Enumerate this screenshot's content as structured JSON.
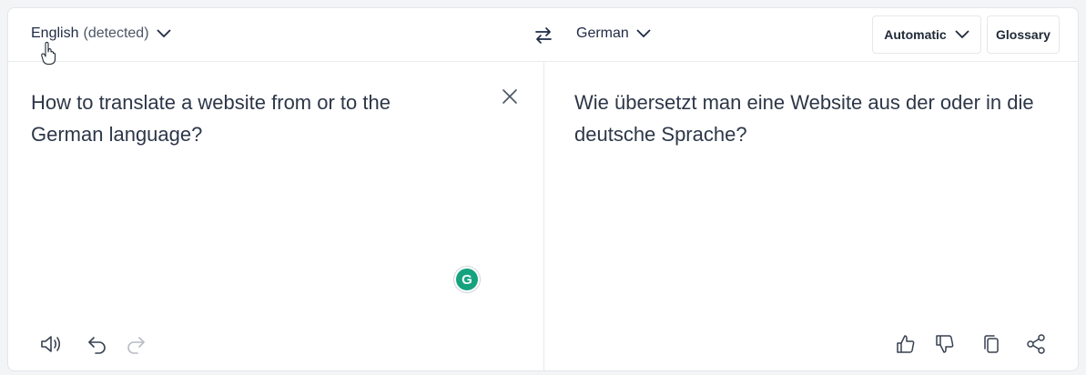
{
  "source": {
    "language": "English",
    "detected_label": "(detected)",
    "text": "How to translate a website from or to the German language?"
  },
  "target": {
    "language": "German",
    "text": "Wie übersetzt man eine Website aus der oder in die deutsche Sprache?"
  },
  "toolbar": {
    "formality_label": "Automatic",
    "glossary_label": "Glossary"
  },
  "grammarly_badge": "G",
  "icons": {
    "source_chevron": "chevron-down-icon",
    "swap": "swap-arrows-icon",
    "target_chevron": "chevron-down-icon",
    "clear": "close-icon",
    "speaker": "speaker-icon",
    "undo": "undo-icon",
    "redo": "redo-icon",
    "thumbs_up": "thumbs-up-icon",
    "thumbs_down": "thumbs-down-icon",
    "copy": "copy-icon",
    "share": "share-icon"
  },
  "colors": {
    "text": "#2d3748",
    "accent_dark": "#1f2a44",
    "grammarly": "#15a37f",
    "border": "#e8eaed"
  }
}
